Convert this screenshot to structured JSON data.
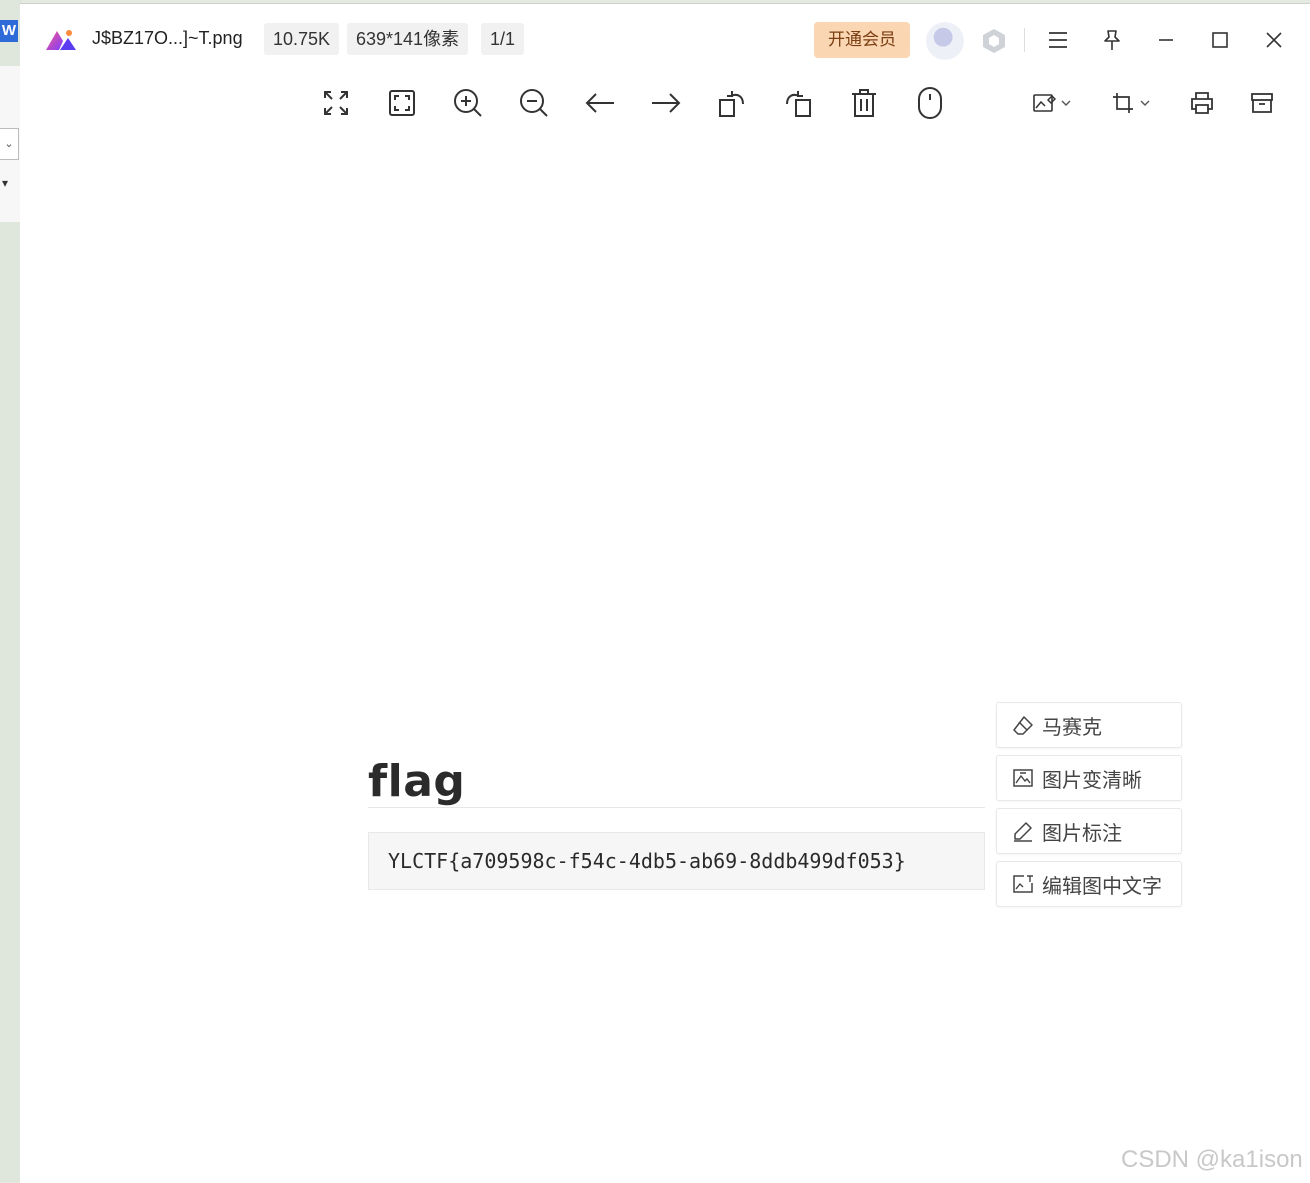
{
  "background_app": {
    "logo_letter": "W"
  },
  "titlebar": {
    "file_name": "J$BZ17O...]~T.png",
    "file_size": "10.75K",
    "dimensions": "639*141像素",
    "page": "1/1",
    "vip_label": "开通会员"
  },
  "toolbar": {
    "tools": [
      "fit-screen-icon",
      "actual-size-icon",
      "zoom-in-icon",
      "zoom-out-icon",
      "previous-icon",
      "next-icon",
      "rotate-left-icon",
      "rotate-right-icon",
      "delete-icon",
      "mouse-icon",
      "image-edit-icon",
      "crop-icon",
      "print-icon",
      "archive-icon"
    ]
  },
  "image": {
    "heading": "flag",
    "code": "YLCTF{a709598c-f54c-4db5-ab69-8ddb499df053}"
  },
  "actions": [
    {
      "label": "马赛克",
      "icon": "eraser-icon"
    },
    {
      "label": "图片变清晰",
      "icon": "image-enhance-icon"
    },
    {
      "label": "图片标注",
      "icon": "pen-icon"
    },
    {
      "label": "编辑图中文字",
      "icon": "image-text-icon"
    }
  ],
  "watermark": "CSDN @ka1ison",
  "colors": {
    "vip_bg": "#fbd6b2",
    "vip_text": "#7a3e12",
    "accent_blue": "#2f6bd8"
  }
}
